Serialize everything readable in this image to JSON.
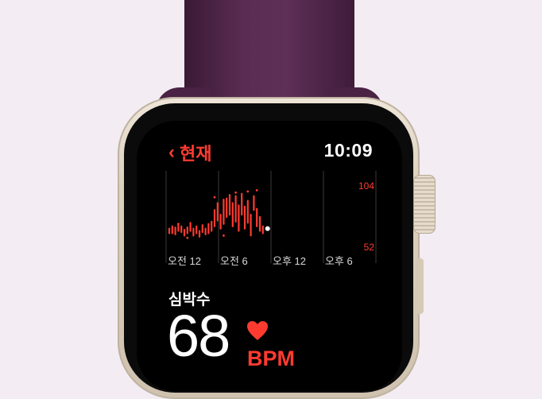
{
  "header": {
    "back_label": "현재",
    "time": "10:09"
  },
  "chart": {
    "y_max_label": "104",
    "y_min_label": "52",
    "x_tick_labels": [
      "오전 12",
      "오전 6",
      "오후 12",
      "오후 6"
    ]
  },
  "reading": {
    "label": "심박수",
    "value": "68",
    "unit": "BPM"
  },
  "chart_data": {
    "type": "range",
    "ylim": [
      52,
      104
    ],
    "y_ticks": [
      104,
      52
    ],
    "x_ticks": [
      "오전 12",
      "오전 6",
      "오후 12",
      "오후 6"
    ],
    "current": 68,
    "bars": [
      [
        64,
        68
      ],
      [
        64,
        70
      ],
      [
        63,
        69
      ],
      [
        66,
        71
      ],
      [
        65,
        70
      ],
      [
        62,
        67
      ],
      [
        64,
        69
      ],
      [
        66,
        73
      ],
      [
        62,
        68
      ],
      [
        64,
        70
      ],
      [
        61,
        66
      ],
      [
        65,
        71
      ],
      [
        63,
        68
      ],
      [
        64,
        72
      ],
      [
        66,
        74
      ],
      [
        70,
        84
      ],
      [
        75,
        90
      ],
      [
        68,
        80
      ],
      [
        72,
        93
      ],
      [
        78,
        94
      ],
      [
        80,
        97
      ],
      [
        70,
        90
      ],
      [
        74,
        96
      ],
      [
        66,
        88
      ],
      [
        80,
        98
      ],
      [
        68,
        87
      ],
      [
        73,
        92
      ],
      [
        62,
        80
      ],
      [
        84,
        96
      ],
      [
        70,
        85
      ],
      [
        66,
        78
      ],
      [
        64,
        70
      ]
    ],
    "dots": [
      [
        3,
        72
      ],
      [
        15,
        95
      ],
      [
        22,
        99
      ],
      [
        26,
        100
      ],
      [
        29,
        101
      ],
      [
        6,
        60
      ],
      [
        18,
        62
      ]
    ]
  },
  "colors": {
    "accent": "#ff3b30",
    "band": "#5a2c53",
    "background": "#f3ecf3"
  }
}
